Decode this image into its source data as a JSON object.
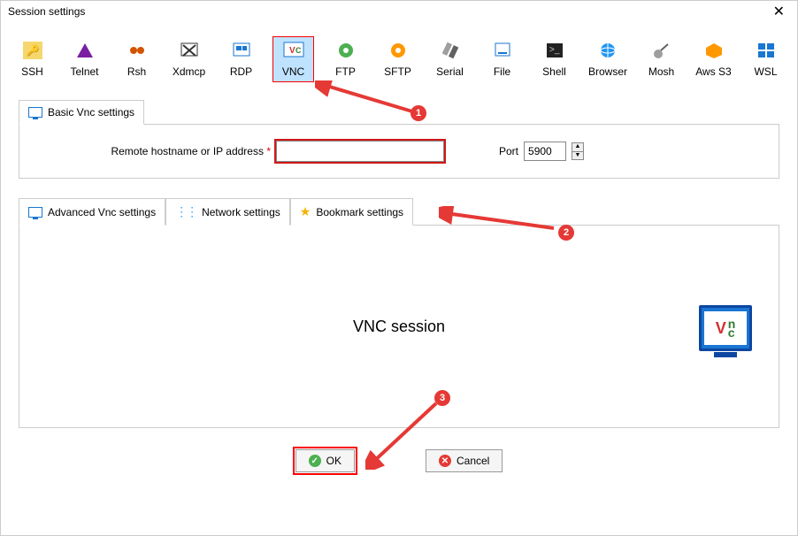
{
  "window": {
    "title": "Session settings"
  },
  "sessions": [
    {
      "label": "SSH"
    },
    {
      "label": "Telnet"
    },
    {
      "label": "Rsh"
    },
    {
      "label": "Xdmcp"
    },
    {
      "label": "RDP"
    },
    {
      "label": "VNC"
    },
    {
      "label": "FTP"
    },
    {
      "label": "SFTP"
    },
    {
      "label": "Serial"
    },
    {
      "label": "File"
    },
    {
      "label": "Shell"
    },
    {
      "label": "Browser"
    },
    {
      "label": "Mosh"
    },
    {
      "label": "Aws S3"
    },
    {
      "label": "WSL"
    }
  ],
  "basic_tab": {
    "label": "Basic Vnc settings"
  },
  "form": {
    "host_label": "Remote hostname or IP address",
    "host_value": "",
    "port_label": "Port",
    "port_value": "5900"
  },
  "lower_tabs": {
    "adv": "Advanced Vnc settings",
    "net": "Network settings",
    "bm": "Bookmark settings"
  },
  "lower_body": {
    "title": "VNC session"
  },
  "buttons": {
    "ok": "OK",
    "cancel": "Cancel"
  },
  "annotations": {
    "n1": "1",
    "n2": "2",
    "n3": "3"
  }
}
